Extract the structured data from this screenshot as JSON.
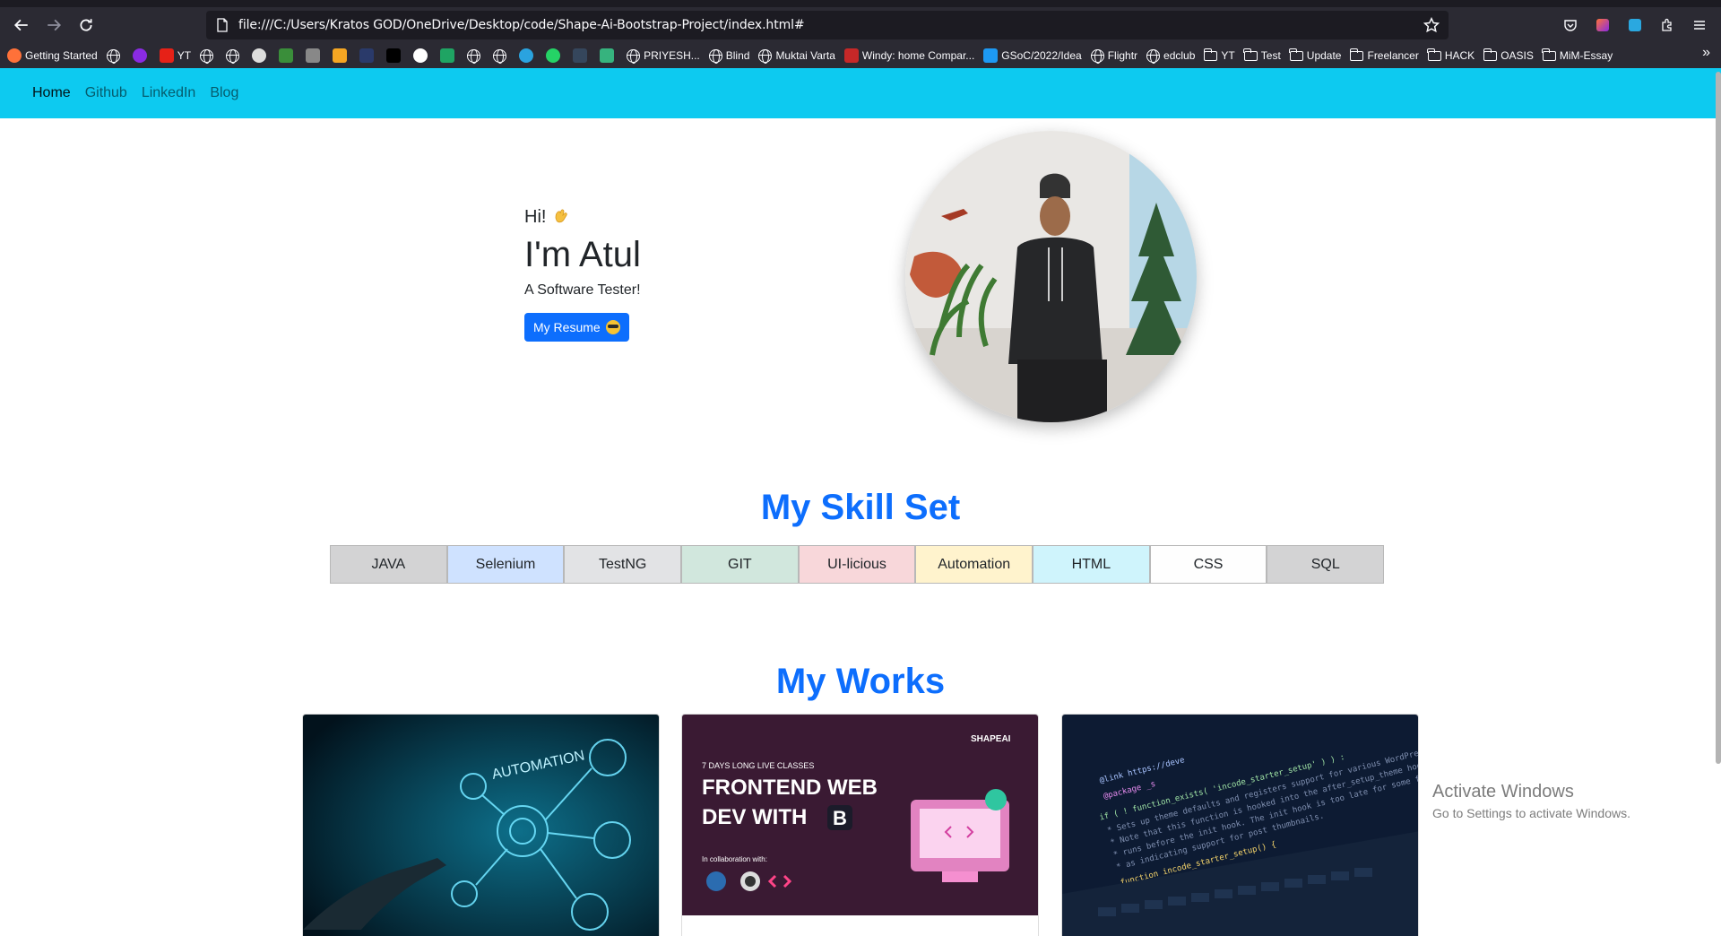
{
  "browser": {
    "url": "file:///C:/Users/Kratos GOD/OneDrive/Desktop/code/Shape-Ai-Bootstrap-Project/index.html#",
    "bookmarks": [
      {
        "label": "Getting Started",
        "icon": "firefox-icon"
      },
      {
        "label": "",
        "icon": "globe-icon"
      },
      {
        "label": "",
        "icon": "u-icon"
      },
      {
        "label": "YT",
        "icon": "youtube-icon"
      },
      {
        "label": "",
        "icon": "globe-icon"
      },
      {
        "label": "",
        "icon": "globe-icon"
      },
      {
        "label": "",
        "icon": "github-icon"
      },
      {
        "label": "",
        "icon": "ext-icon"
      },
      {
        "label": "",
        "icon": "cc-icon"
      },
      {
        "label": "",
        "icon": "bolt-icon"
      },
      {
        "label": "",
        "icon": "app-icon"
      },
      {
        "label": "",
        "icon": "hi-icon"
      },
      {
        "label": "",
        "icon": "google-icon"
      },
      {
        "label": "",
        "icon": "drive-icon"
      },
      {
        "label": "",
        "icon": "globe-icon"
      },
      {
        "label": "",
        "icon": "globe-icon"
      },
      {
        "label": "",
        "icon": "telegram-icon"
      },
      {
        "label": "",
        "icon": "whatsapp-icon"
      },
      {
        "label": "",
        "icon": "tumblr-icon"
      },
      {
        "label": "",
        "icon": "chat-icon"
      },
      {
        "label": "PRIYESH...",
        "icon": "globe-icon"
      },
      {
        "label": "Blind",
        "icon": "globe-icon"
      },
      {
        "label": "Muktai Varta",
        "icon": "globe-icon"
      },
      {
        "label": "Windy: home Compar...",
        "icon": "windy-icon"
      },
      {
        "label": "GSoC/2022/Idea",
        "icon": "kde-icon"
      },
      {
        "label": "Flightr",
        "icon": "globe-icon"
      },
      {
        "label": "edclub",
        "icon": "globe-icon"
      },
      {
        "label": "YT",
        "icon": "folder-icon"
      },
      {
        "label": "Test",
        "icon": "folder-icon"
      },
      {
        "label": "Update",
        "icon": "folder-icon"
      },
      {
        "label": "Freelancer",
        "icon": "folder-icon"
      },
      {
        "label": "HACK",
        "icon": "folder-icon"
      },
      {
        "label": "OASIS",
        "icon": "folder-icon"
      },
      {
        "label": "MiM-Essay",
        "icon": "folder-icon"
      }
    ]
  },
  "nav": {
    "home": "Home",
    "github": "Github",
    "linkedin": "LinkedIn",
    "blog": "Blog"
  },
  "hero": {
    "greeting": "Hi!",
    "name": "I'm Atul",
    "tagline": "A Software Tester!",
    "resume_button": "My Resume"
  },
  "skills": {
    "title": "My Skill Set",
    "items": [
      "JAVA",
      "Selenium",
      "TestNG",
      "GIT",
      "UI-licious",
      "Automation",
      "HTML",
      "CSS",
      "SQL"
    ]
  },
  "works": {
    "title": "My Works",
    "card1": {
      "label": "AUTOMATION"
    },
    "card2": {
      "brand": "SHAPEAI",
      "kicker": "7 DAYS LONG LIVE CLASSES",
      "line1": "FRONTEND WEB",
      "line2": "DEV WITH",
      "badge": "B",
      "collab": "In collaboration with:"
    },
    "card3": {
      "code1": "@link https://deve",
      "code2": "@package _s",
      "code3": "if ( ! function_exists( 'incode_starter_setup' ) ) :",
      "code4": "* Sets up theme defaults and registers support for various WordPress",
      "code5": "* Note that this function is hooked into the after_setup_theme hook",
      "code6": "* runs before the init hook. The init hook is too late for some features",
      "code7": "* as indicating support for post thumbnails.",
      "code8": "function incode_starter_setup() {"
    }
  },
  "watermark": {
    "line1": "Activate Windows",
    "line2": "Go to Settings to activate Windows."
  },
  "colors": {
    "navbar": "#0dcaf0",
    "primary": "#0d6efd"
  }
}
